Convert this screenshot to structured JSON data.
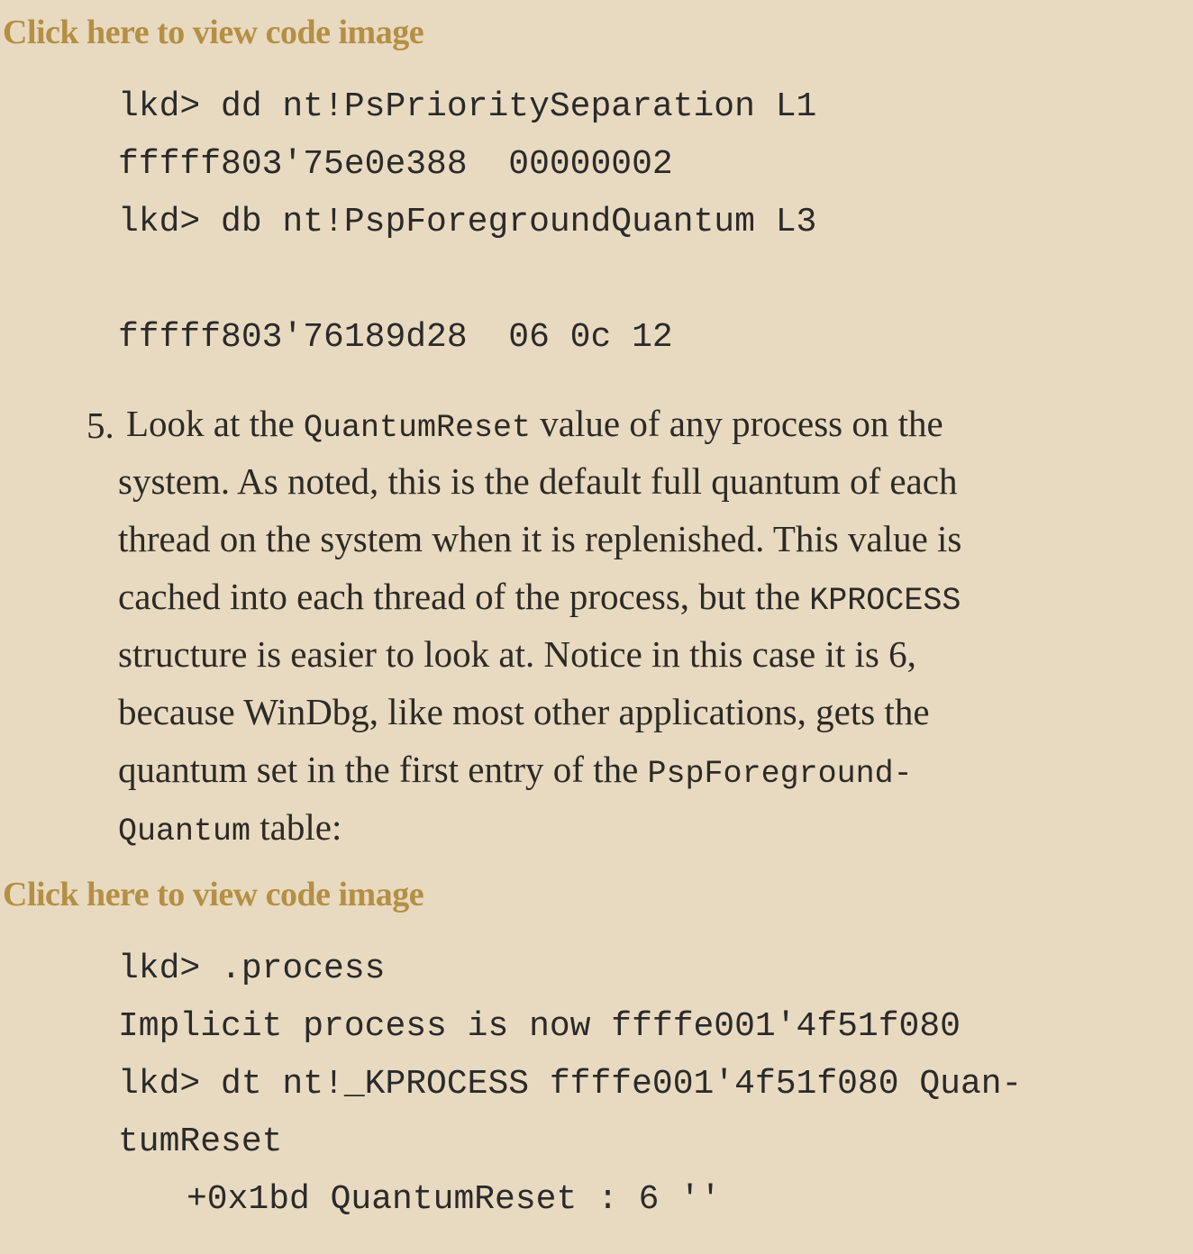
{
  "code_link_1": "Click here to view code image",
  "code_block_1": [
    "lkd> dd nt!PsPrioritySeparation L1",
    "fffff803'75e0e388  00000002",
    "lkd> db nt!PspForegroundQuantum L3",
    "fffff803'76189d28  06 0c 12"
  ],
  "step": {
    "number": "5.",
    "lines": [
      {
        "before": "Look at the ",
        "code": "QuantumReset",
        "after": " value of any process on the"
      },
      {
        "text": "system. As noted, this is the default full quantum of each"
      },
      {
        "text": "thread on the system when it is replenished. This value is"
      },
      {
        "before": "cached into each thread of the process, but the ",
        "code": "KPROCESS"
      },
      {
        "text": "structure is easier to look at. Notice in this case it is 6,"
      },
      {
        "text": "because WinDbg, like most other applications, gets the"
      },
      {
        "before": "quantum set in the first entry of the ",
        "code": "PspForeground-"
      },
      {
        "code": "Quantum",
        "after": " table:"
      }
    ]
  },
  "code_link_2": "Click here to view code image",
  "code_block_2": [
    "lkd> .process",
    "Implicit process is now ffffe001'4f51f080",
    "lkd> dt nt!_KPROCESS ffffe001'4f51f080 Quan-",
    "tumReset",
    "+0x1bd QuantumReset : 6 ''"
  ]
}
